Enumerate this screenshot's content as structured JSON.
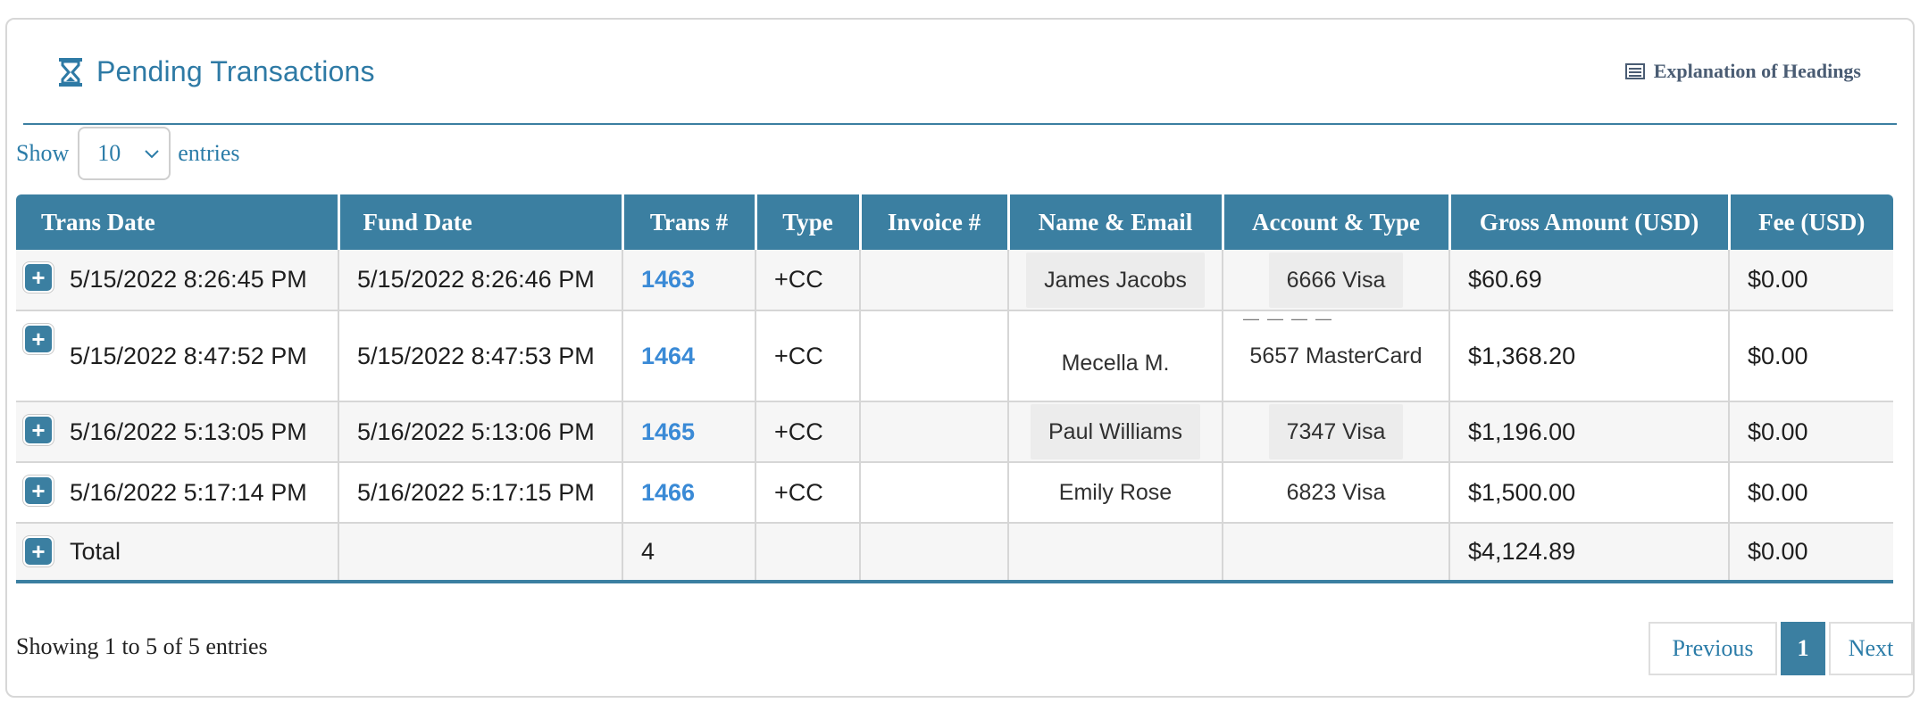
{
  "panel": {
    "title": "Pending Transactions",
    "explanation_link": "Explanation of Headings"
  },
  "length_control": {
    "show_label": "Show",
    "value": "10",
    "entries_label": "entries"
  },
  "table": {
    "columns": [
      "Trans Date",
      "Fund Date",
      "Trans #",
      "Type",
      "Invoice #",
      "Name & Email",
      "Account & Type",
      "Gross Amount (USD)",
      "Fee (USD)"
    ],
    "rows": [
      {
        "trans_date": "5/15/2022 8:26:45 PM",
        "fund_date": "5/15/2022 8:26:46 PM",
        "trans_no": "1463",
        "type": "+CC",
        "invoice": "",
        "name": "James Jacobs",
        "account": "6666 Visa",
        "gross": "$60.69",
        "fee": "$0.00"
      },
      {
        "trans_date": "5/15/2022 8:47:52 PM",
        "fund_date": "5/15/2022 8:47:53 PM",
        "trans_no": "1464",
        "type": "+CC",
        "invoice": "",
        "name": "Mecella M.",
        "account": "5657 MasterCard",
        "gross": "$1,368.20",
        "fee": "$0.00"
      },
      {
        "trans_date": "5/16/2022 5:13:05 PM",
        "fund_date": "5/16/2022 5:13:06 PM",
        "trans_no": "1465",
        "type": "+CC",
        "invoice": "",
        "name": "Paul Williams",
        "account": "7347 Visa",
        "gross": "$1,196.00",
        "fee": "$0.00"
      },
      {
        "trans_date": "5/16/2022 5:17:14 PM",
        "fund_date": "5/16/2022 5:17:15 PM",
        "trans_no": "1466",
        "type": "+CC",
        "invoice": "",
        "name": "Emily Rose",
        "account": "6823 Visa",
        "gross": "$1,500.00",
        "fee": "$0.00"
      }
    ],
    "total": {
      "label": "Total",
      "count": "4",
      "gross": "$4,124.89",
      "fee": "$0.00"
    }
  },
  "footer": {
    "info": "Showing 1 to 5 of 5 entries",
    "previous": "Previous",
    "current_page": "1",
    "next": "Next"
  },
  "colors": {
    "accent": "#3b7fa1",
    "title": "#2e7aa5",
    "link": "#3a8ad6"
  }
}
